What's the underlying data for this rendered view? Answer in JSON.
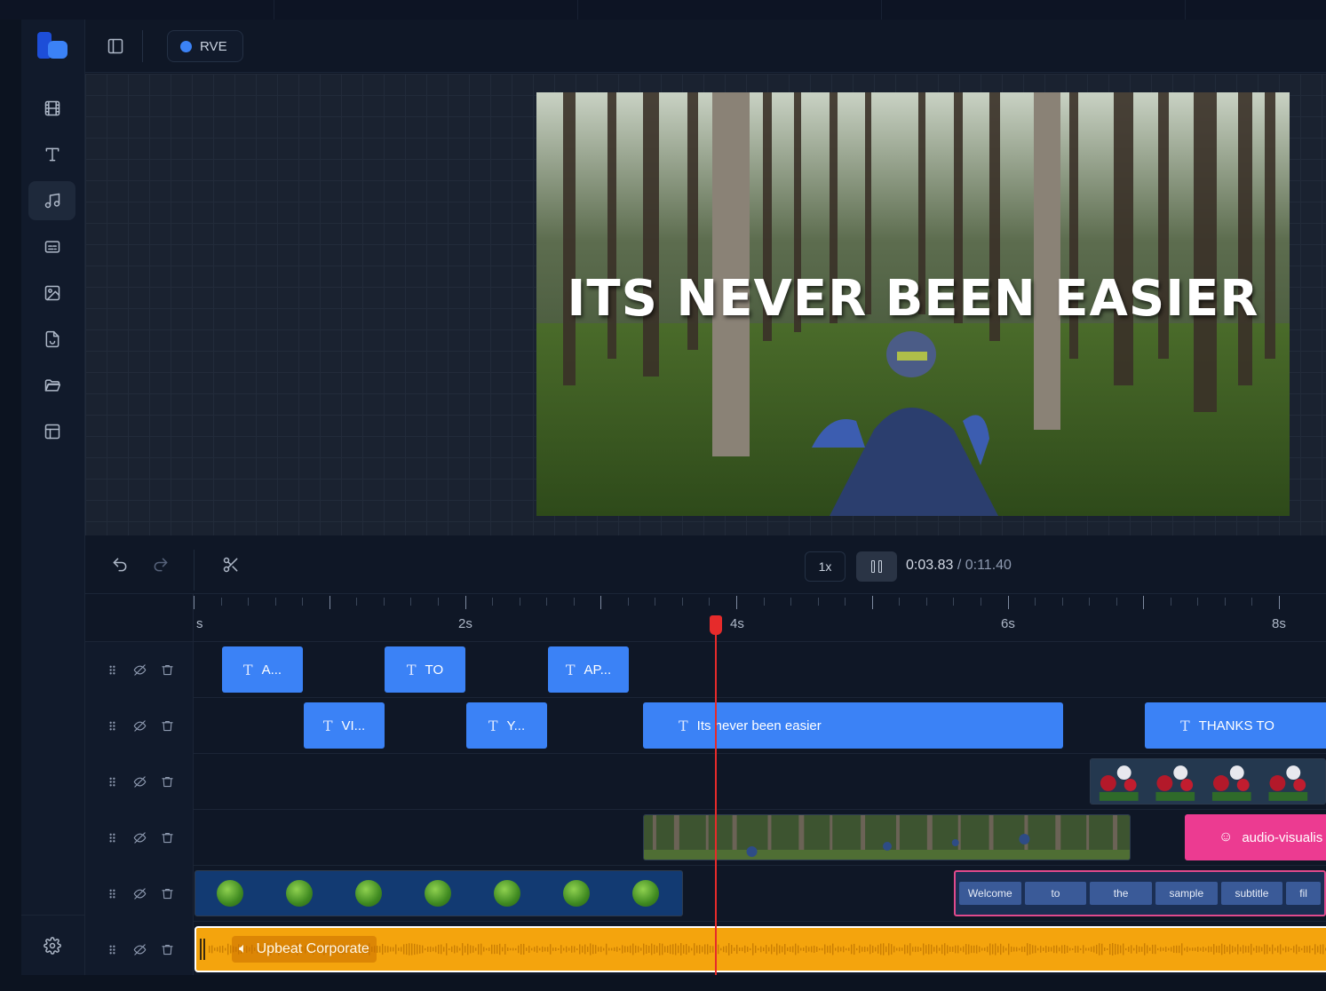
{
  "app": {
    "project_name": "RVE"
  },
  "sidebar": {
    "items": [
      {
        "name": "video",
        "icon": "film-icon"
      },
      {
        "name": "text",
        "icon": "text-icon"
      },
      {
        "name": "audio",
        "icon": "music-icon",
        "active": true
      },
      {
        "name": "captions",
        "icon": "captions-icon"
      },
      {
        "name": "images",
        "icon": "image-icon"
      },
      {
        "name": "stickers",
        "icon": "sticker-icon"
      },
      {
        "name": "uploads",
        "icon": "folder-icon"
      },
      {
        "name": "templates",
        "icon": "layout-icon"
      }
    ],
    "settings_icon": "gear-icon"
  },
  "preview": {
    "overlay_text": "ITS NEVER BEEN EASIER"
  },
  "toolbar": {
    "speed": "1x",
    "current_time": "0:03.83",
    "separator": " / ",
    "total_time": "0:11.40"
  },
  "ruler": {
    "labels": [
      "s",
      "2s",
      "4s",
      "6s",
      "8s"
    ]
  },
  "tracks": {
    "row1": [
      "A...",
      "TO",
      "AP..."
    ],
    "row2": [
      "VI...",
      "Y...",
      "Its never been easier",
      "THANKS TO"
    ],
    "audio_visualizer_label": "audio-visualis",
    "subtitle_words": [
      "Welcome",
      "to",
      "the",
      "sample",
      "subtitle",
      "fil"
    ],
    "audio_label": "Upbeat Corporate"
  },
  "colors": {
    "accent": "#3b82f6",
    "playhead": "#e62b2b",
    "audio": "#f4a40d",
    "visualizer": "#ec3b91"
  }
}
